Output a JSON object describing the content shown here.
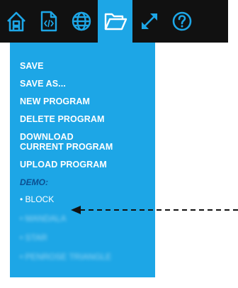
{
  "toolbar": {
    "buttons": [
      {
        "icon": "home-icon"
      },
      {
        "icon": "code-file-icon"
      },
      {
        "icon": "globe-icon"
      },
      {
        "icon": "folder-open-icon",
        "active": true
      },
      {
        "icon": "expand-icon"
      },
      {
        "icon": "help-icon"
      }
    ]
  },
  "menu": {
    "save": "SAVE",
    "save_as": "SAVE AS...",
    "new_program": "NEW PROGRAM",
    "delete_program": "DELETE PROGRAM",
    "download_line1": "DOWNLOAD",
    "download_line2": "CURRENT PROGRAM",
    "upload_program": "UPLOAD PROGRAM",
    "demo_label": "DEMO:",
    "demos": [
      "• BLOCK",
      "• MANDALA",
      "• STAR",
      "• PENROSE TRIANGLE"
    ]
  },
  "colors": {
    "toolbar_bg": "#111111",
    "accent": "#1da6e6",
    "demo_label": "#0b4f91",
    "icon_stroke": "#1da6e6",
    "active_icon_stroke": "#ffffff"
  }
}
